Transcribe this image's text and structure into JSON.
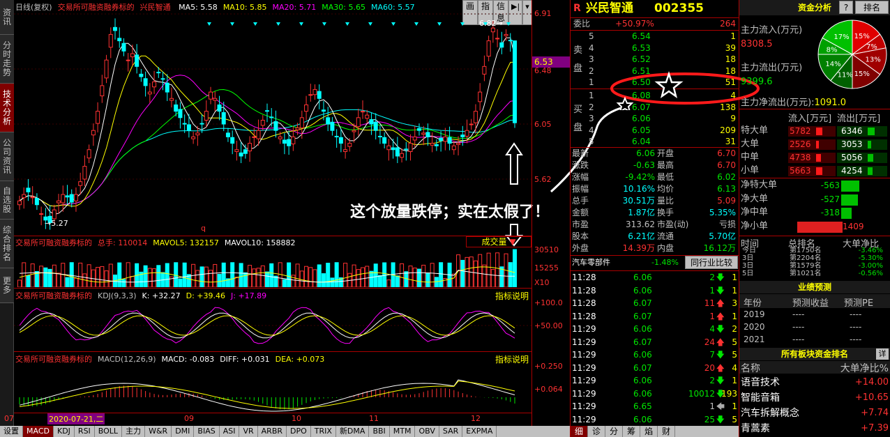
{
  "left_tabs": [
    {
      "label": "资讯",
      "active": false,
      "h": 50
    },
    {
      "label": "分时走势",
      "active": false,
      "h": 70
    },
    {
      "label": "技术分析",
      "active": true,
      "h": 70
    },
    {
      "label": "公司资讯",
      "active": false,
      "h": 70
    },
    {
      "label": "自选股",
      "active": false,
      "h": 55
    },
    {
      "label": "综合排名",
      "active": false,
      "h": 70
    },
    {
      "label": "更多",
      "active": false,
      "h": 50
    }
  ],
  "chart": {
    "header_name": "日线(复权)",
    "header_title": "交易所可融资融券标的",
    "stock_name": "兴民智通",
    "ma": [
      {
        "label": "MA5: 5.58",
        "color": "#ffffff"
      },
      {
        "label": "MA10: 5.85",
        "color": "#ffff00"
      },
      {
        "label": "MA20: 5.71",
        "color": "#ff00ff"
      },
      {
        "label": "MA30: 5.65",
        "color": "#00ff00"
      },
      {
        "label": "MA60: 5.57",
        "color": "#00ffff"
      }
    ],
    "buttons": [
      "画",
      "指",
      "信息"
    ],
    "price_axis": [
      "6.91",
      "6.48",
      "6.05",
      "5.62"
    ],
    "current_price_tag": "6.53",
    "high_label": "6.82",
    "low_label": "5.27",
    "marker_q": "q",
    "annotation": "这个放量跌停；实在太假了！",
    "vol_header": {
      "title": "交易所可融资融券标的",
      "total": "总手: 110014",
      "mavol5": "MAVOL5: 132157",
      "mavol10": "MAVOL10: 158882"
    },
    "vol_axis": [
      "30510",
      "15255",
      "X10"
    ],
    "vol_button": "成交量",
    "kdj_header": {
      "title": "交易所可融资融券标的",
      "params": "KDJ(9,3,3)",
      "k": "K: +32.27",
      "d": "D: +39.46",
      "j": "J: +17.89"
    },
    "kdj_axis": [
      "+100.0",
      "+50.00"
    ],
    "macd_header": {
      "title": "交易所可融资融券标的",
      "params": "MACD(12,26,9)",
      "macd": "MACD: -0.083",
      "diff": "DIFF: +0.031",
      "dea": "DEA: +0.073"
    },
    "macd_axis": [
      "+0.250",
      "+0.064"
    ],
    "indicator_btn": "指标说明",
    "date_axis": [
      "07",
      "2020-07-21,二",
      "09",
      "10",
      "11",
      "12"
    ]
  },
  "bottom_tabs": [
    "设置",
    "MACD",
    "KDJ",
    "RSI",
    "BOLL",
    "主力",
    "W&R",
    "DMI",
    "BIAS",
    "ASI",
    "VR",
    "ARBR",
    "DPO",
    "TRIX",
    "新DMA",
    "BBI",
    "MTM",
    "OBV",
    "SAR",
    "EXPMA"
  ],
  "bottom_active": "MACD",
  "quote": {
    "name": "兴民智通",
    "code": "002355",
    "weibi_label": "委比",
    "weibi_val": "+50.97%",
    "weibi_diff": "264",
    "sell_label": "卖盘",
    "buy_label": "买盘",
    "sells": [
      {
        "lv": "5",
        "price": "6.54",
        "vol": "1"
      },
      {
        "lv": "4",
        "price": "6.53",
        "vol": "39"
      },
      {
        "lv": "3",
        "price": "6.52",
        "vol": "18"
      },
      {
        "lv": "2",
        "price": "6.51",
        "vol": "18"
      },
      {
        "lv": "1",
        "price": "6.50",
        "vol": "51"
      }
    ],
    "buys": [
      {
        "lv": "1",
        "price": "6.08",
        "vol": "4"
      },
      {
        "lv": "2",
        "price": "6.07",
        "vol": "138"
      },
      {
        "lv": "3",
        "price": "6.06",
        "vol": "9"
      },
      {
        "lv": "4",
        "price": "6.05",
        "vol": "209"
      },
      {
        "lv": "5",
        "price": "6.04",
        "vol": "31"
      }
    ],
    "stats": [
      {
        "l1": "最新",
        "v1": "6.06",
        "c1": "green",
        "l2": "开盘",
        "v2": "6.70",
        "c2": "red"
      },
      {
        "l1": "涨跌",
        "v1": "-0.63",
        "c1": "green",
        "l2": "最高",
        "v2": "6.70",
        "c2": "red"
      },
      {
        "l1": "涨幅",
        "v1": "-9.42%",
        "c1": "green",
        "l2": "最低",
        "v2": "6.02",
        "c2": "green"
      },
      {
        "l1": "振幅",
        "v1": "10.16%",
        "c1": "cyan",
        "l2": "均价",
        "v2": "6.13",
        "c2": "green"
      },
      {
        "l1": "总手",
        "v1": "30.51万",
        "c1": "cyan",
        "l2": "量比",
        "v2": "5.09",
        "c2": "red"
      },
      {
        "l1": "金额",
        "v1": "1.87亿",
        "c1": "cyan",
        "l2": "换手",
        "v2": "5.35%",
        "c2": "cyan"
      },
      {
        "l1": "市盈",
        "v1": "313.62",
        "c1": "gray",
        "l2": "市盈(动)",
        "v2": "亏损",
        "c2": "gray"
      },
      {
        "l1": "股本",
        "v1": "6.21亿",
        "c1": "cyan",
        "l2": "流通",
        "v2": "5.70亿",
        "c2": "cyan"
      },
      {
        "l1": "外盘",
        "v1": "14.39万",
        "c1": "red",
        "l2": "内盘",
        "v2": "16.12万",
        "c2": "green"
      }
    ],
    "sector_name": "汽车零部件",
    "sector_pct": "-1.48%",
    "sector_btn": "同行业比较",
    "ticks": [
      {
        "t": "11:28",
        "p": "6.06",
        "v": "2",
        "dir": "down",
        "n": "1"
      },
      {
        "t": "11:28",
        "p": "6.06",
        "v": "1",
        "dir": "down",
        "n": "1"
      },
      {
        "t": "11:28",
        "p": "6.07",
        "v": "11",
        "dir": "up",
        "n": "3"
      },
      {
        "t": "11:28",
        "p": "6.07",
        "v": "1",
        "dir": "up",
        "n": "1"
      },
      {
        "t": "11:29",
        "p": "6.06",
        "v": "4",
        "dir": "down",
        "n": "2"
      },
      {
        "t": "11:29",
        "p": "6.07",
        "v": "24",
        "dir": "up",
        "n": "5"
      },
      {
        "t": "11:29",
        "p": "6.06",
        "v": "7",
        "dir": "down",
        "n": "5"
      },
      {
        "t": "11:29",
        "p": "6.07",
        "v": "20",
        "dir": "up",
        "n": "4"
      },
      {
        "t": "11:29",
        "p": "6.06",
        "v": "2",
        "dir": "down",
        "n": "1"
      },
      {
        "t": "11:29",
        "p": "6.06",
        "v": "10012",
        "dir": "down",
        "n": "193"
      },
      {
        "t": "11:29",
        "p": "6.65",
        "v": "1",
        "dir": "left",
        "n": "1"
      },
      {
        "t": "11:29",
        "p": "6.06",
        "v": "25",
        "dir": "down",
        "n": "5"
      }
    ],
    "bottom_tabs": [
      "细",
      "诊",
      "分",
      "筹",
      "焰",
      "财"
    ]
  },
  "funds": {
    "title": "资金分析",
    "btn_help": "?",
    "btn_rank": "排名",
    "inflow_label": "主力流入(万元)",
    "inflow_val": "8308.5",
    "outflow_label": "主力流出(万元)",
    "outflow_val": "9399.6",
    "net_label": "主力净流出(万元):",
    "net_val": "1091.0",
    "pie": [
      {
        "label": "15%",
        "value": 15,
        "color": "#e00000"
      },
      {
        "label": "7%",
        "value": 7,
        "color": "#c00000"
      },
      {
        "label": "13%",
        "value": 13,
        "color": "#a00000"
      },
      {
        "label": "15%",
        "value": 15,
        "color": "#800000"
      },
      {
        "label": "11%",
        "value": 11,
        "color": "#006000"
      },
      {
        "label": "14%",
        "value": 14,
        "color": "#008000"
      },
      {
        "label": "8%",
        "value": 8,
        "color": "#00a000"
      },
      {
        "label": "17%",
        "value": 17,
        "color": "#00c000"
      }
    ],
    "flow_header": [
      "流入[万元]",
      "流出[万元]"
    ],
    "flows": [
      {
        "label": "特大单",
        "in": "5782",
        "out": "6346"
      },
      {
        "label": "大单",
        "in": "2526",
        "out": "3053"
      },
      {
        "label": "中单",
        "in": "4738",
        "out": "5056"
      },
      {
        "label": "小单",
        "in": "5663",
        "out": "4254"
      }
    ],
    "net": [
      {
        "label": "净特大单",
        "val": "-563",
        "color": "green",
        "bar": 0.26
      },
      {
        "label": "净大单",
        "val": "-527",
        "color": "green",
        "bar": 0.24
      },
      {
        "label": "净中单",
        "val": "-318",
        "color": "green",
        "bar": 0.15
      },
      {
        "label": "净小单",
        "val": "1409",
        "color": "red",
        "bar": 0.65
      }
    ],
    "rank_header": [
      "时间",
      "总排名",
      "大单净比"
    ],
    "ranks": [
      {
        "t": "今日",
        "rank": "第1750名",
        "v": "-3.46%"
      },
      {
        "t": "3日",
        "rank": "第2204名",
        "v": "-5.30%"
      },
      {
        "t": "3日",
        "rank": "第1579名",
        "v": "-3.00%"
      },
      {
        "t": "5日",
        "rank": "第1021名",
        "v": "-0.56%"
      }
    ],
    "forecast_title": "业绩预测",
    "forecast_header": [
      "年份",
      "预测收益",
      "预测PE"
    ],
    "forecast": [
      {
        "y": "2019",
        "e": "----",
        "pe": "----"
      },
      {
        "y": "2020",
        "e": "----",
        "pe": "----"
      },
      {
        "y": "2021",
        "e": "----",
        "pe": "----"
      }
    ],
    "sector_rank_title": "所有板块资金排名",
    "sector_rank_btn": "详",
    "sector_rank_header": [
      "名称",
      "大单净比%"
    ],
    "sector_ranks": [
      {
        "name": "语音技术",
        "v": "+14.00"
      },
      {
        "name": "智能音箱",
        "v": "+10.65"
      },
      {
        "name": "汽车拆解概念",
        "v": "+7.74"
      },
      {
        "name": "青蒿素",
        "v": "+7.39"
      }
    ]
  }
}
